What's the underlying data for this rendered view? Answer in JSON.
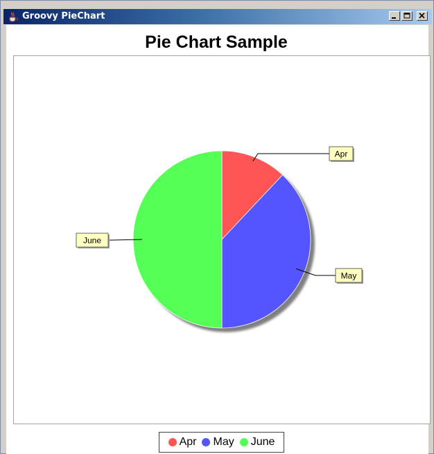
{
  "window": {
    "title": "Groovy PieChart"
  },
  "chart_data": {
    "type": "pie",
    "title": "Pie Chart Sample",
    "slices": [
      {
        "label": "Apr",
        "value": 12,
        "color": "#ff5555"
      },
      {
        "label": "May",
        "value": 38,
        "color": "#5555ff"
      },
      {
        "label": "June",
        "value": 50,
        "color": "#55ff55"
      }
    ],
    "legend_position": "bottom",
    "grid": false
  }
}
